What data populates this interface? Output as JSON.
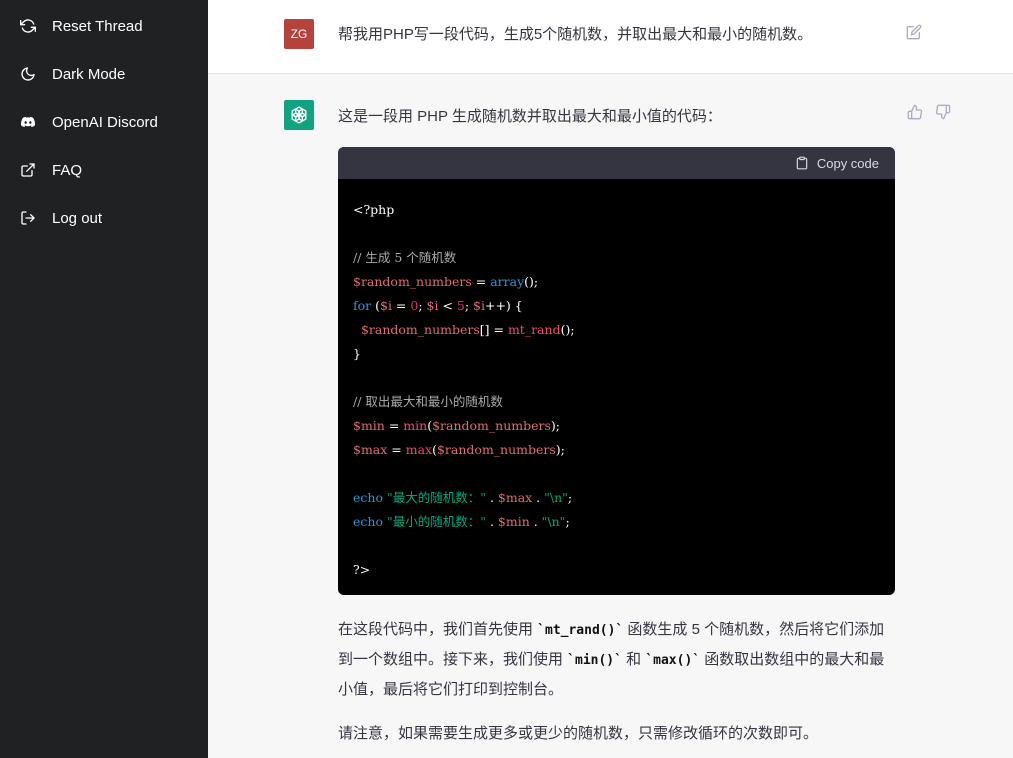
{
  "sidebar": {
    "items": [
      {
        "label": "Reset Thread",
        "icon": "refresh-icon"
      },
      {
        "label": "Dark Mode",
        "icon": "moon-icon"
      },
      {
        "label": "OpenAI Discord",
        "icon": "discord-icon"
      },
      {
        "label": "FAQ",
        "icon": "external-link-icon"
      },
      {
        "label": "Log out",
        "icon": "logout-icon"
      }
    ]
  },
  "user_message": {
    "avatar_initials": "ZG",
    "avatar_color": "#b5423b",
    "text": "帮我用PHP写一段代码，生成5个随机数，并取出最大和最小的随机数。"
  },
  "bot_message": {
    "avatar_color": "#10a37f",
    "intro": "这是一段用 PHP 生成随机数并取出最大和最小值的代码：",
    "copy_label": "Copy code",
    "code_lines": [
      "<?php",
      "",
      "// 生成 5 个随机数",
      "$random_numbers = array();",
      "for ($i = 0; $i < 5; $i++) {",
      "  $random_numbers[] = mt_rand();",
      "}",
      "",
      "// 取出最大和最小的随机数",
      "$min = min($random_numbers);",
      "$max = max($random_numbers);",
      "",
      "echo \"最大的随机数：\" . $max . \"\\n\";",
      "echo \"最小的随机数：\" . $min . \"\\n\";",
      "",
      "?>"
    ],
    "paragraph1": {
      "p1": "在这段代码中，我们首先使用 ",
      "code1": "`mt_rand()`",
      "p2": " 函数生成 5 个随机数，然后将它们添加到一个数组中。接下来，我们使用 ",
      "code2": "`min()`",
      "p3": " 和 ",
      "code3": "`max()`",
      "p4": " 函数取出数组中的最大和最小值，最后将它们打印到控制台。"
    },
    "paragraph2": "请注意，如果需要生成更多或更少的随机数，只需修改循环的次数即可。"
  },
  "colors": {
    "sidebar_bg": "#202123",
    "code_bg": "#000000",
    "code_header_bg": "#343541"
  }
}
